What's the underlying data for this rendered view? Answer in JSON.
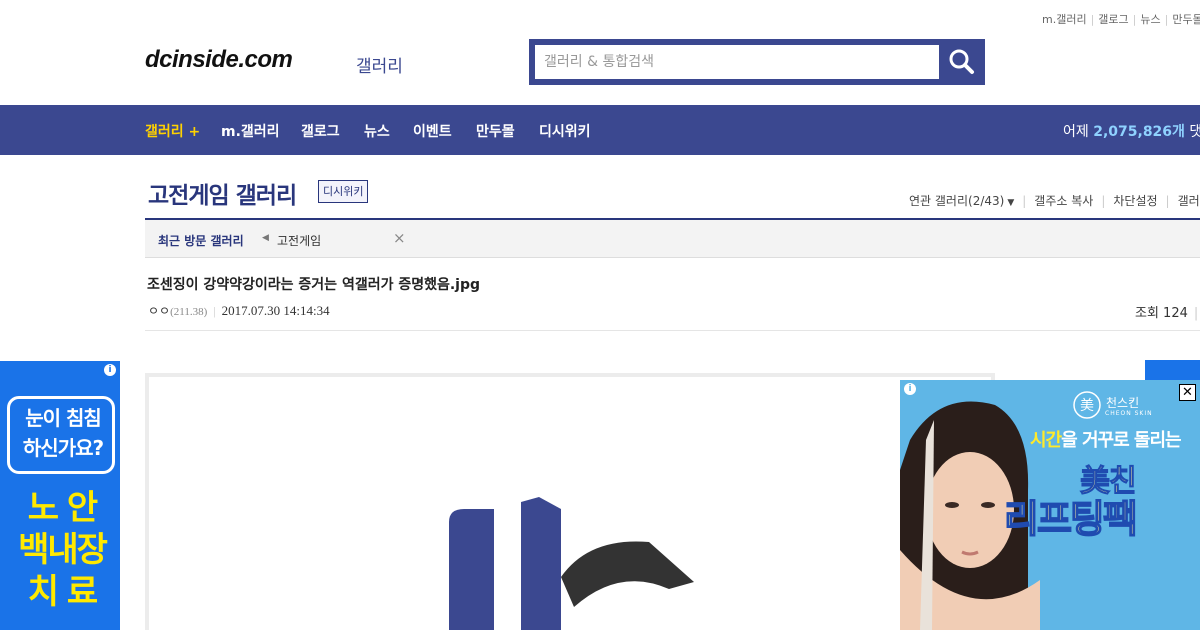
{
  "top_util": [
    "m.갤러리",
    "갤로그",
    "뉴스",
    "만두몰"
  ],
  "header": {
    "logo": "dcinside.com",
    "logo_sub": "갤러리",
    "search_placeholder": "갤러리 & 통합검색"
  },
  "nav": {
    "items": [
      "갤러리 +",
      "m.갤러리",
      "갤로그",
      "뉴스",
      "이벤트",
      "만두몰",
      "디시위키"
    ],
    "stat_label": "어제",
    "stat_value": "2,075,826개",
    "stat_suffix": "댓글"
  },
  "gallery": {
    "title": "고전게임 갤러리",
    "wiki_button": "디시위키",
    "related": "연관 갤러리(2/43)",
    "copy_address": "갤주소 복사",
    "block_settings": "차단설정",
    "more": "갤러"
  },
  "recent": {
    "label": "최근 방문 갤러리",
    "galleries": [
      "고전게임"
    ]
  },
  "post": {
    "title": "조센징이 강약약강이라는 증거는 역갤러가 증명했음.jpg",
    "author": "ㅇㅇ",
    "ip": "(211.38)",
    "date": "2017.07.30 14:14:34",
    "views_label": "조회 124"
  },
  "ads": {
    "left": {
      "bubble_line1": "눈이 침침",
      "bubble_line2": "하신가요?",
      "big_line1": "노 안",
      "big_line2": "백내장",
      "big_line3": "치 료"
    },
    "right": {
      "brand": "천스킨",
      "brand_sub": "CHEON SKIN",
      "tagline_highlight": "시간",
      "tagline_rest": "을 거꾸로 돌리는",
      "headline1": "美친",
      "headline2": "리프팅팩"
    }
  },
  "colors": {
    "brand": "#3b4890",
    "nav_highlight": "#ffd200",
    "stat_value": "#8fd2ff",
    "ad_left_bg": "#1a73e8",
    "ad_left_text": "#ffe900",
    "ad_right_bg": "#5fb6e6"
  }
}
